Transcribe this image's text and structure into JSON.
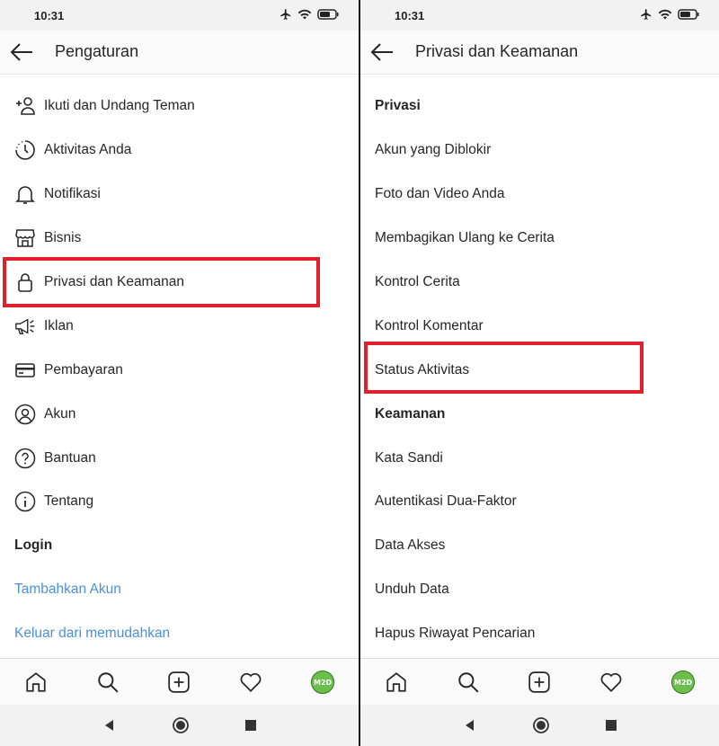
{
  "left": {
    "status": {
      "time": "10:31"
    },
    "header": {
      "title": "Pengaturan"
    },
    "items": [
      {
        "label": "Ikuti dan Undang Teman",
        "icon": "add-person-icon"
      },
      {
        "label": "Aktivitas Anda",
        "icon": "activity-clock-icon"
      },
      {
        "label": "Notifikasi",
        "icon": "bell-icon"
      },
      {
        "label": "Bisnis",
        "icon": "shop-icon"
      },
      {
        "label": "Privasi dan Keamanan",
        "icon": "lock-icon",
        "highlighted": true
      },
      {
        "label": "Iklan",
        "icon": "megaphone-icon"
      },
      {
        "label": "Pembayaran",
        "icon": "card-icon"
      },
      {
        "label": "Akun",
        "icon": "account-icon"
      },
      {
        "label": "Bantuan",
        "icon": "help-icon"
      },
      {
        "label": "Tentang",
        "icon": "info-icon"
      }
    ],
    "login_header": "Login",
    "links": [
      "Tambahkan Akun",
      "Keluar dari memudahkan"
    ]
  },
  "right": {
    "status": {
      "time": "10:31"
    },
    "header": {
      "title": "Privasi dan Keamanan"
    },
    "privacy_header": "Privasi",
    "privacy_items": [
      "Akun yang Diblokir",
      "Foto dan Video Anda",
      "Membagikan Ulang ke Cerita",
      "Kontrol Cerita",
      "Kontrol Komentar",
      "Status Aktivitas"
    ],
    "security_header": "Keamanan",
    "security_items": [
      "Kata Sandi",
      "Autentikasi Dua-Faktor",
      "Data Akses",
      "Unduh Data",
      "Hapus Riwayat Pencarian"
    ]
  },
  "bottom_nav": {
    "avatar_text": "M2D"
  },
  "colors": {
    "highlight": "#e0202b",
    "link": "#4a90d9",
    "avatar": "#6cbf4a"
  }
}
